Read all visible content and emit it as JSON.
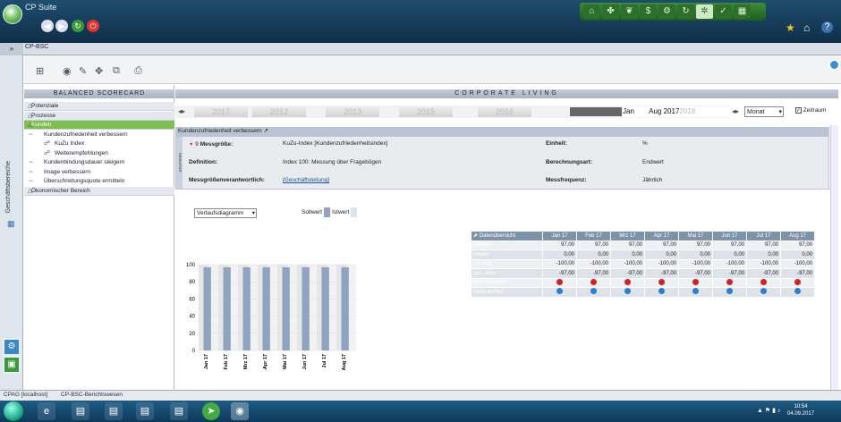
{
  "app": {
    "title": "CP Suite"
  },
  "tab": {
    "label": "CP-BSC",
    "toggle": "»"
  },
  "rail": {
    "label": "Geschäftsbereiche"
  },
  "left": {
    "header": "BALANCED SCORECARD",
    "items": [
      {
        "label": "Potenziale",
        "level": 0
      },
      {
        "label": "Prozesse",
        "level": 0
      },
      {
        "label": "Kunden",
        "level": 0,
        "active": true
      },
      {
        "label": "Kundenzufriedenheit verbessern",
        "level": 1
      },
      {
        "label": "KuZu Index",
        "level": 2
      },
      {
        "label": "Weiterempfehlungen",
        "level": 2
      },
      {
        "label": "Kundenbindungsdauer steigern",
        "level": 1
      },
      {
        "label": "Image verbessern",
        "level": 1
      },
      {
        "label": "Überschreitungsquote ermitteln",
        "level": 1
      },
      {
        "label": "Ökonomischer Bereich",
        "level": 0
      }
    ]
  },
  "right": {
    "header": "CORPORATE LIVING",
    "years": [
      "2017",
      "2012",
      "2013",
      "2015",
      "2016"
    ],
    "period_start": "Jan",
    "period_end": "Aug 2017",
    "period_tail": "2018",
    "granularity": "Monat",
    "zeitraum": "Zeitraum",
    "kpi_title": "Kundenzufriedenheit verbessern",
    "indicator": "INDIKATOR",
    "kpi": {
      "messgroesse_label": "Messgröße:",
      "messgroesse_num": "9",
      "messgroesse": "KuZu-Index [Kundenzufriedenheitsindex]",
      "einheit_label": "Einheit:",
      "einheit": "%",
      "definition_label": "Definition:",
      "definition": "Index 100: Messung über Fragebögen",
      "berechnung_label": "Berechnungsart:",
      "berechnung": "Endwert",
      "verantw_label": "Messgrößenverantwortlich:",
      "verantw": "[Geschäftsleitung]",
      "freq_label": "Messfrequenz:",
      "freq": "Jährlich"
    },
    "chart_type_select": "Verlaufsdiagramm",
    "legend": {
      "soll": "Sollwert",
      "ist": "Istwert"
    }
  },
  "chart_data": {
    "type": "bar",
    "categories": [
      "Jan 17",
      "Feb 17",
      "Mrz 17",
      "Apr 17",
      "Mai 17",
      "Jun 17",
      "Jul 17",
      "Aug 17"
    ],
    "series": [
      {
        "name": "Sollwert",
        "values": [
          97,
          97,
          97,
          97,
          97,
          97,
          97,
          97
        ]
      },
      {
        "name": "Istwert",
        "values": [
          0,
          0,
          0,
          0,
          0,
          0,
          0,
          0
        ]
      }
    ],
    "yticks": [
      "100",
      "80",
      "60",
      "40",
      "20",
      "0"
    ],
    "ylim": [
      0,
      100
    ],
    "colors": {
      "soll": "#8ea4c0",
      "ist": "#dce4ec"
    }
  },
  "table": {
    "head": "Datenübersicht",
    "columns": [
      "Jan 17",
      "Feb 17",
      "Mrz 17",
      "Apr 17",
      "Mai 17",
      "Jun 17",
      "Jul 17",
      "Aug 17"
    ],
    "rows": [
      {
        "label": "Sollwert",
        "values": [
          "97,00",
          "97,00",
          "97,00",
          "97,00",
          "97,00",
          "97,00",
          "97,00",
          "97,00"
        ]
      },
      {
        "label": "Istwert",
        "values": [
          "0,00",
          "0,00",
          "0,00",
          "0,00",
          "0,00",
          "0,00",
          "0,00",
          "0,00"
        ]
      },
      {
        "label": "rel. Abw.",
        "values": [
          "-100,00",
          "-100,00",
          "-100,00",
          "-100,00",
          "-100,00",
          "-100,00",
          "-100,00",
          "-100,00"
        ]
      },
      {
        "label": "abs. Abw.",
        "values": [
          "-97,00",
          "-97,00",
          "-97,00",
          "-97,00",
          "-97,00",
          "-97,00",
          "-97,00",
          "-97,00"
        ]
      }
    ],
    "warn_label": "Warnhinweise",
    "massn_label": "Maßnahmen"
  },
  "status": {
    "left": "CPAG [localhost]",
    "right": "CP-BSC-Berichtswesen"
  },
  "clock": {
    "time": "10:54",
    "date": "04.09.2017"
  }
}
